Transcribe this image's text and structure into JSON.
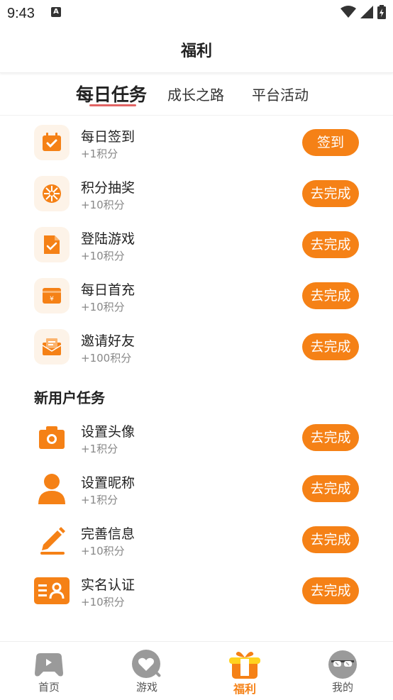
{
  "status_bar": {
    "time": "9:43",
    "notif_glyph": "A"
  },
  "header": {
    "title": "福利"
  },
  "tabs": [
    {
      "label": "每日任务",
      "active": true
    },
    {
      "label": "成长之路",
      "active": false
    },
    {
      "label": "平台活动",
      "active": false
    }
  ],
  "daily_tasks": [
    {
      "name": "每日签到",
      "reward": "+1积分",
      "button": "签到",
      "icon": "calendar-check-icon"
    },
    {
      "name": "积分抽奖",
      "reward": "+10积分",
      "button": "去完成",
      "icon": "lottery-wheel-icon"
    },
    {
      "name": "登陆游戏",
      "reward": "+10积分",
      "button": "去完成",
      "icon": "document-check-icon"
    },
    {
      "name": "每日首充",
      "reward": "+10积分",
      "button": "去完成",
      "icon": "wallet-yen-icon"
    },
    {
      "name": "邀请好友",
      "reward": "+100积分",
      "button": "去完成",
      "icon": "envelope-invite-icon"
    }
  ],
  "new_user_section": {
    "title": "新用户任务"
  },
  "new_user_tasks": [
    {
      "name": "设置头像",
      "reward": "+1积分",
      "button": "去完成",
      "icon": "camera-icon"
    },
    {
      "name": "设置昵称",
      "reward": "+1积分",
      "button": "去完成",
      "icon": "user-icon"
    },
    {
      "name": "完善信息",
      "reward": "+10积分",
      "button": "去完成",
      "icon": "pencil-edit-icon"
    },
    {
      "name": "实名认证",
      "reward": "+10积分",
      "button": "去完成",
      "icon": "id-card-icon"
    }
  ],
  "bottom_nav": [
    {
      "label": "首页",
      "icon": "gamepad-icon",
      "active": false
    },
    {
      "label": "游戏",
      "icon": "game-heart-icon",
      "active": false
    },
    {
      "label": "福利",
      "icon": "gift-icon",
      "active": true
    },
    {
      "label": "我的",
      "icon": "profile-sunglasses-icon",
      "active": false
    }
  ],
  "colors": {
    "accent": "#f58116",
    "tab_underline": "#e26464",
    "icon_bg": "#fdf3e8"
  }
}
